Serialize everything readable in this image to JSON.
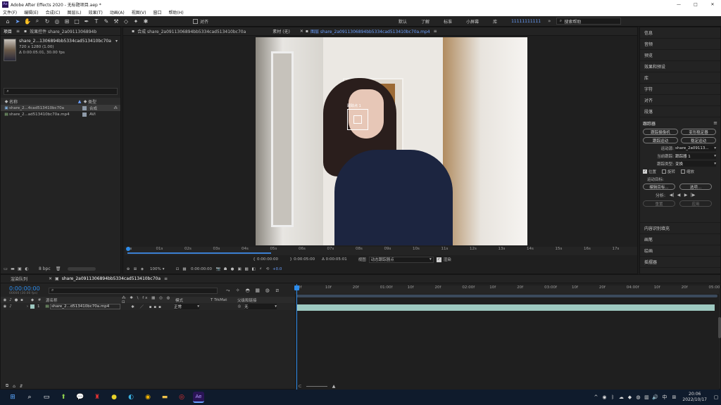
{
  "title_bar": {
    "app_title": "Adobe After Effects 2020 - 无标题项目.aep *",
    "minimize": "—",
    "maximize": "□",
    "close": "✕"
  },
  "menu": [
    "文件(F)",
    "编辑(E)",
    "合成(C)",
    "图层(L)",
    "效果(T)",
    "动画(A)",
    "视图(V)",
    "窗口",
    "帮助(H)"
  ],
  "toolbar": {
    "snap_label": "对齐",
    "workspaces": [
      "默认",
      "了解",
      "标准",
      "小屏幕",
      "库"
    ],
    "active_workspace": "11111111111",
    "search_placeholder": "搜索帮助"
  },
  "project_panel": {
    "tab_project": "项目",
    "tab_effects": "效果控件 share_2a0911306894b",
    "file_name": "share_2...1306894bb5334cad513410bc70a",
    "file_size": "720 x 1280 (1.00)",
    "file_duration": "Δ 0:00:05:01, 30.00 fps",
    "col_name": "名称",
    "col_type": "类型",
    "items": [
      {
        "name": "share_2...4cad513410bc70a",
        "type": "合成"
      },
      {
        "name": "share_2...ad513410bc70a.mp4",
        "type": "AVI"
      }
    ],
    "bpc": "8 bpc"
  },
  "comp_panel": {
    "tab_comp": "合成 share_2a0911306894bb5334cad513410bc70a",
    "tab_footage": "素材 (无)",
    "tab_layer": "图层 share_2a0911306894bb5334cad513410bc70a.mp4",
    "track_point_label": "跟踪点 1",
    "ruler_ticks": [
      "0s",
      "01s",
      "02s",
      "03s",
      "04s",
      "05s",
      "06s",
      "07s",
      "08s",
      "09s",
      "10s",
      "11s",
      "12s",
      "13s",
      "14s",
      "15s",
      "16s",
      "17s"
    ],
    "time_in": "0:00:00:00",
    "time_out": "0:00:05:00",
    "duration": "Δ 0:00:05:01",
    "view_label": "视图",
    "view_value": "动态跟踪器点",
    "render_label": "渲染",
    "zoom": "100%",
    "current_time": "0:00:00:00",
    "exposure": "+0.0",
    "opacity": "100 %"
  },
  "right_panel": {
    "items_top": [
      "信息",
      "音频",
      "预览",
      "效果和预设",
      "库",
      "字符",
      "对齐",
      "段落"
    ],
    "tracker": {
      "title": "跟踪器",
      "btn_camera": "跟踪摄像机",
      "btn_warp": "变形稳定器",
      "btn_track_motion": "跟踪运动",
      "btn_stabilize": "稳定运动",
      "motion_source_label": "运动源:",
      "motion_source_value": "share_2a09113...",
      "current_track_label": "当前跟踪:",
      "current_track_value": "跟踪器 1",
      "track_type_label": "跟踪类型:",
      "track_type_value": "变换",
      "chk_position": "位置",
      "chk_rotation": "旋转",
      "chk_scale": "缩放",
      "motion_target_label": "运动目标:",
      "btn_edit_target": "编辑目标...",
      "btn_options": "选项...",
      "analyze_label": "分析:",
      "btn_reset": "重置",
      "btn_apply": "应用"
    },
    "items_bottom": [
      "内容识别填充",
      "画笔",
      "绘画",
      "摇摆器"
    ]
  },
  "timeline": {
    "tab_render": "渲染队列",
    "tab_comp": "share_2a0911306894bb5334cad513410bc70a",
    "timecode": "0:00:00:00",
    "timecode_sub": "00000 (30.00 fps)",
    "col_layer_name": "源名称",
    "col_mode": "模式",
    "col_trkmat": "T TrkMat",
    "col_parent": "父级和链接",
    "layer_num": "1",
    "layer_name": "share_2...d513410bc70a.mp4",
    "layer_mode": "正常",
    "layer_parent": "无",
    "ruler_ticks": [
      "0f",
      "10f",
      "20f",
      "01:00f",
      "10f",
      "20f",
      "02:00f",
      "10f",
      "20f",
      "03:00f",
      "10f",
      "20f",
      "04:00f",
      "10f",
      "20f",
      "05:00"
    ]
  },
  "taskbar": {
    "time": "20:06",
    "date": "2022/10/17",
    "ime": "中"
  },
  "colors": {
    "accent": "#2d8ceb",
    "layer_bar": "#9ec9c1",
    "ae_purple": "#2a1456",
    "panel": "#232323"
  }
}
